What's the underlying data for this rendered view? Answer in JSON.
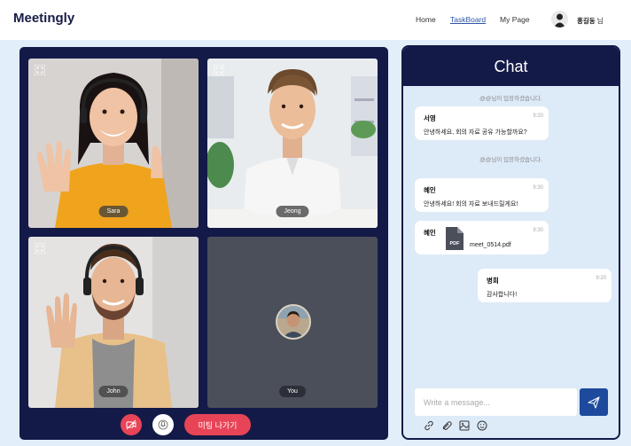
{
  "header": {
    "logo": "Meetingly",
    "nav": [
      {
        "label": "Home",
        "active": false
      },
      {
        "label": "TaskBoard",
        "active": true
      },
      {
        "label": "My Page",
        "active": false
      }
    ],
    "user_name": "홍길동",
    "user_suffix": "님"
  },
  "video": {
    "participants": [
      {
        "name": "Sara",
        "shirt_color": "#f0a31c"
      },
      {
        "name": "Jeong",
        "shirt_color": "#f4f4f4"
      },
      {
        "name": "John",
        "shirt_color": "#e8c08a"
      },
      {
        "name": "You",
        "shirt_color": ""
      }
    ],
    "controls": {
      "camera_icon": "camera-off-icon",
      "mic_icon": "mic-icon",
      "leave_label": "미팅 나가기"
    }
  },
  "chat": {
    "title": "Chat",
    "system_messages": [
      "@@님이 입장하셨습니다.",
      "@@님이 입장하셨습니다."
    ],
    "messages": [
      {
        "sender": "서영",
        "time": "9:20",
        "text": "안녕하세요, 회의 자료 공유 가능할까요?"
      },
      {
        "sender": "혜인",
        "time": "9:30",
        "text": "안녕하세요! 회의 자료 보내드릴게요!"
      },
      {
        "sender": "혜인",
        "time": "9:30",
        "file_name": "meet_0514.pdf",
        "file_type": "PDF"
      },
      {
        "sender": "병희",
        "time": "9:20",
        "text": "감사합니다!"
      }
    ],
    "input_placeholder": "Write a message...",
    "tools": [
      "link-icon",
      "paperclip-icon",
      "image-icon",
      "emoji-icon"
    ]
  },
  "colors": {
    "navy": "#141a47",
    "accent_red": "#e84457",
    "send_blue": "#1d4a9c",
    "background": "#e3eefb"
  }
}
